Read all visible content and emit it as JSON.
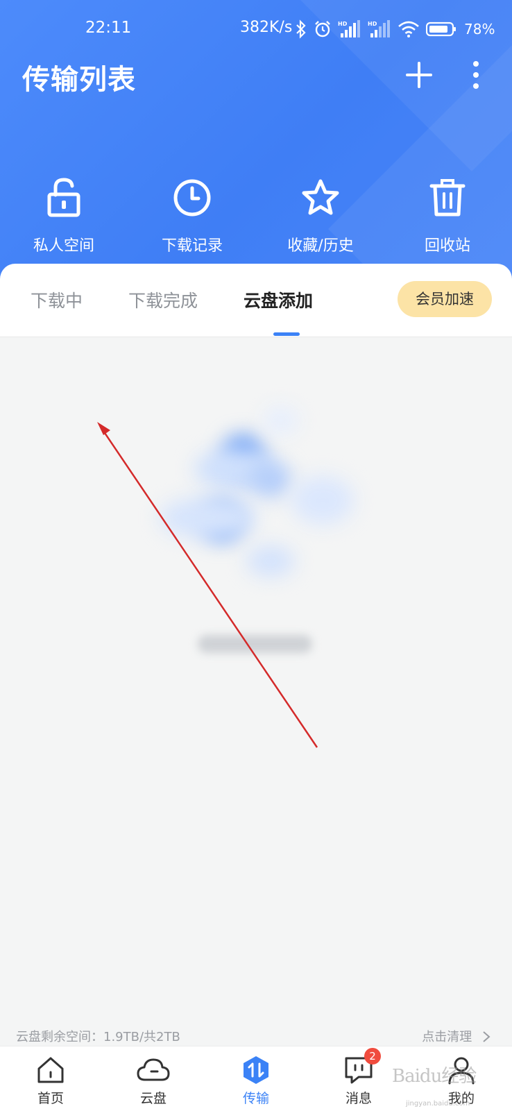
{
  "status_bar": {
    "time": "22:11",
    "net_speed": "382K/s",
    "battery": "78%"
  },
  "header": {
    "title": "传输列表"
  },
  "quick_actions": [
    {
      "label": "私人空间",
      "icon": "unlock-icon"
    },
    {
      "label": "下载记录",
      "icon": "clock-icon"
    },
    {
      "label": "收藏/历史",
      "icon": "star-icon"
    },
    {
      "label": "回收站",
      "icon": "trash-icon"
    }
  ],
  "tabs": [
    {
      "label": "下载中"
    },
    {
      "label": "下载完成"
    },
    {
      "label": "云盘添加",
      "active": true
    }
  ],
  "vip_button": "会员加速",
  "footer": {
    "storage": "云盘剩余空间：1.9TB/共2TB",
    "clean": "点击清理"
  },
  "nav": [
    {
      "label": "首页",
      "icon": "home-icon"
    },
    {
      "label": "云盘",
      "icon": "cloud-icon"
    },
    {
      "label": "传输",
      "icon": "transfer-icon",
      "active": true
    },
    {
      "label": "消息",
      "icon": "message-icon",
      "badge": "2"
    },
    {
      "label": "我的",
      "icon": "user-icon"
    }
  ],
  "watermark": {
    "text": "Baidu经验",
    "sub": "jingyan.baidu.com"
  },
  "colors": {
    "accent": "#3b82f6",
    "header": "#4285f6",
    "vip": "#fce3a6",
    "badge": "#f04c3e"
  }
}
